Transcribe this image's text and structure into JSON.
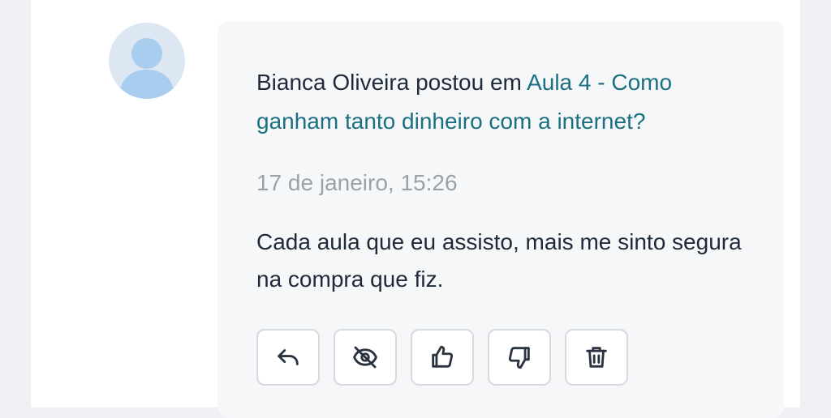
{
  "post": {
    "author": "Bianca Oliveira",
    "action_text": " postou em ",
    "lesson_link": "Aula 4 - Como ganham tanto dinheiro com a internet?",
    "timestamp": "17 de janeiro, 15:26",
    "body": "Cada aula que eu assisto, mais me sinto segura na compra que fiz."
  },
  "actions": [
    {
      "name": "reply",
      "icon": "reply-icon"
    },
    {
      "name": "hide",
      "icon": "eye-off-icon"
    },
    {
      "name": "like",
      "icon": "thumbs-up-icon"
    },
    {
      "name": "dislike",
      "icon": "thumbs-down-icon"
    },
    {
      "name": "delete",
      "icon": "trash-icon"
    }
  ],
  "colors": {
    "link": "#1b6f82",
    "text": "#1e2a3a",
    "muted": "#9aa1ab",
    "bubble": "#f6f7f9",
    "avatar_bg": "#dce7f3",
    "avatar_figure": "#a9cdee"
  }
}
